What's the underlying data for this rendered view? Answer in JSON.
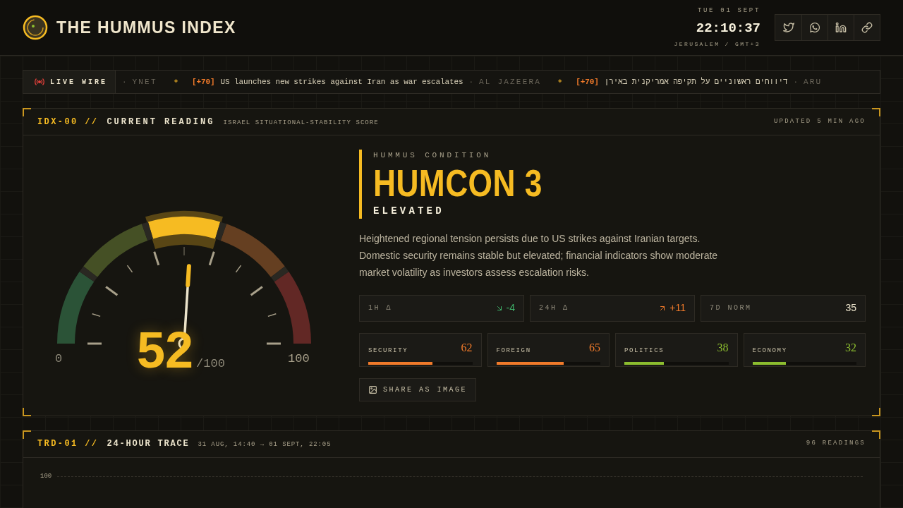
{
  "header": {
    "title": "THE HUMMUS INDEX",
    "date": "TUE 01 SEPT",
    "time": "22:10:37",
    "zone": "JERUSALEM / GMT+3"
  },
  "share_buttons": [
    {
      "kind": "twitter"
    },
    {
      "kind": "whatsapp"
    },
    {
      "kind": "linkedin"
    },
    {
      "kind": "link"
    }
  ],
  "ticker": {
    "label": "LIVE WIRE",
    "items": [
      {
        "kind": "source",
        "sep": "·",
        "text": "YNET"
      },
      {
        "kind": "diamond",
        "text": "◆"
      },
      {
        "kind": "headline",
        "tag": "[+70]",
        "text": "US launches new strikes against Iran as war escalates"
      },
      {
        "kind": "source",
        "sep": "·",
        "text": "AL JAZEERA"
      },
      {
        "kind": "diamond",
        "text": "◆"
      },
      {
        "kind": "headline",
        "tag": "[+70]",
        "text": "דיווחים ראשוניים על תקיפה אמריקנית באירן"
      },
      {
        "kind": "source",
        "sep": "·",
        "text": "ARU"
      }
    ]
  },
  "reading_panel": {
    "code": "IDX-00 //",
    "title": "CURRENT READING",
    "subtitle": "ISRAEL SITUATIONAL-STABILITY SCORE",
    "updated": "UPDATED 5 MIN AGO",
    "gauge": {
      "level": 0.52,
      "value": "52",
      "max": "/100",
      "min_label": "0",
      "max_label": "100"
    },
    "condition": {
      "label": "HUMMUS CONDITION",
      "title": "HUMCON 3",
      "status": "ELEVATED"
    },
    "description": "Heightened regional tension persists due to US strikes against Iranian targets. Domestic security remains stable but elevated; financial indicators show moderate market volatility as investors assess escalation risks.",
    "deltas": [
      {
        "label": "1H Δ",
        "value": "-4",
        "kind": "down"
      },
      {
        "label": "24H Δ",
        "value": "+11",
        "kind": "up"
      },
      {
        "label": "7D NORM",
        "value": "35",
        "kind": "flat"
      }
    ],
    "scores": [
      {
        "label": "SECURITY",
        "value": "62",
        "level": 0.62,
        "color": "#f07a2a"
      },
      {
        "label": "FOREIGN",
        "value": "65",
        "level": 0.65,
        "color": "#f07a2a"
      },
      {
        "label": "POLITICS",
        "value": "38",
        "level": 0.38,
        "color": "#8cbd2f"
      },
      {
        "label": "ECONOMY",
        "value": "32",
        "level": 0.32,
        "color": "#8cbd2f"
      }
    ],
    "share_label": "SHARE AS IMAGE"
  },
  "trace_panel": {
    "code": "TRD-01 //",
    "title": "24-HOUR TRACE",
    "range": "31 AUG, 14:40 → 01 SEPT, 22:05",
    "count": "96 READINGS",
    "y_tick": "100"
  }
}
